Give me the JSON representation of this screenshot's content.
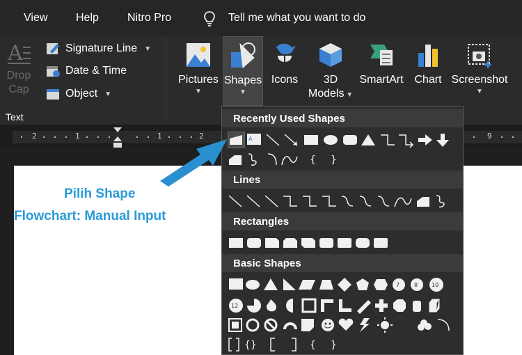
{
  "menu": {
    "items": [
      "View",
      "Help",
      "Nitro Pro"
    ],
    "tell_me": "Tell me what you want to do"
  },
  "ribbon": {
    "drop_cap": [
      "Drop",
      "Cap"
    ],
    "text_group_label": "Text",
    "signature_line": "Signature Line",
    "date_time": "Date & Time",
    "object": "Object",
    "pictures": "Pictures",
    "shapes": "Shapes",
    "icons": "Icons",
    "models_3d": [
      "3D",
      "Models"
    ],
    "smartart": "SmartArt",
    "chart": "Chart",
    "screenshot": "Screenshot"
  },
  "ruler": {
    "numbers": [
      "2",
      "1",
      "1",
      "2",
      "9"
    ]
  },
  "callout": {
    "line1": "Pilih Shape",
    "line2": "Flowchart: Manual Input"
  },
  "gallery": {
    "sections": {
      "recent": "Recently Used Shapes",
      "lines": "Lines",
      "rectangles": "Rectangles",
      "basic": "Basic Shapes"
    },
    "icon_names": [
      "flowchart-manual-input",
      "text-box",
      "line",
      "arrow",
      "rectangle",
      "oval",
      "rounded-rectangle",
      "triangle",
      "elbow-connector",
      "curved-connector",
      "right-arrow",
      "down-arrow"
    ]
  },
  "colors": {
    "callout": "#2a9ad8",
    "ribbon": "#2b2b2b",
    "menubar": "#262626",
    "section": "#3b3b3b"
  }
}
